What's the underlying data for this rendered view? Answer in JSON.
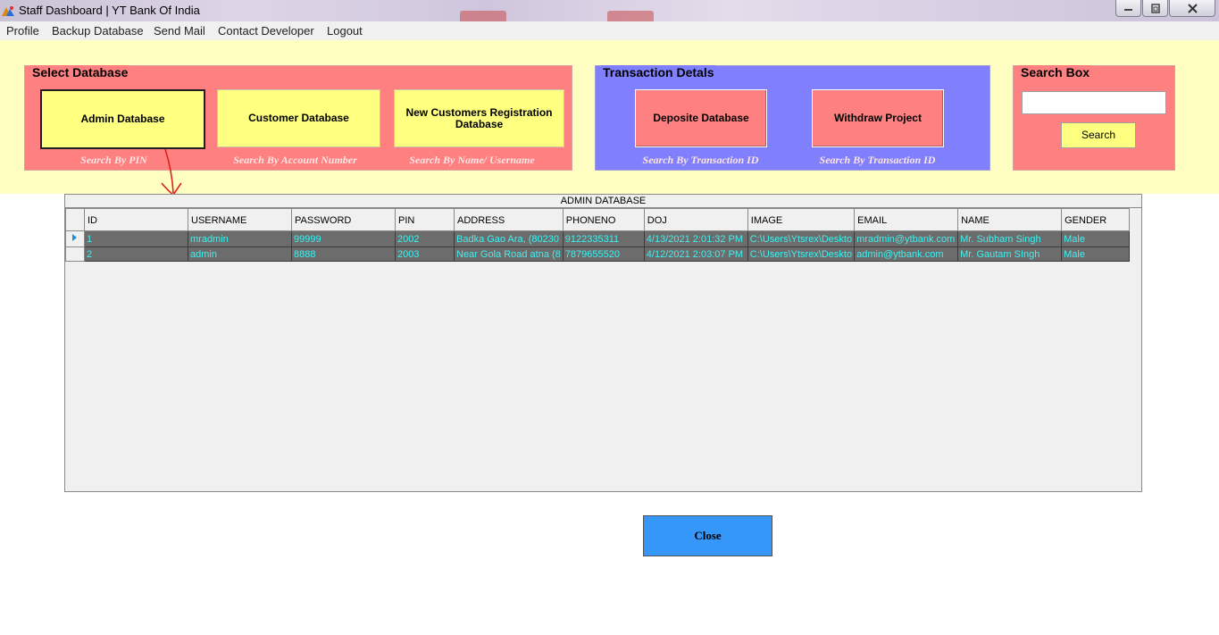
{
  "window": {
    "title": "Staff Dashboard | YT Bank Of India",
    "minimize": "minimize-icon",
    "restore": "restore-icon",
    "close": "close-icon"
  },
  "menu": {
    "items": [
      "Profile",
      "Backup Database",
      "Send Mail",
      "Contact Developer",
      "Logout"
    ]
  },
  "select_database": {
    "title": "Select Database",
    "buttons": [
      "Admin Database",
      "Customer Database",
      "New Customers Registration Database"
    ],
    "hints": [
      "Search By PIN",
      "Search By Account Number",
      "Search By Name/ Username"
    ]
  },
  "transaction": {
    "title": "Transaction Detals",
    "buttons": [
      "Deposite Database",
      "Withdraw Project"
    ],
    "hints": [
      "Search By Transaction ID",
      "Search By Transaction ID"
    ]
  },
  "search_box": {
    "title": "Search Box",
    "input_value": "",
    "button": "Search"
  },
  "grid": {
    "caption": "ADMIN DATABASE",
    "columns": [
      "ID",
      "USERNAME",
      "PASSWORD",
      "PIN",
      "ADDRESS",
      "PHONENO",
      "DOJ",
      "IMAGE",
      "EMAIL",
      "NAME",
      "GENDER"
    ],
    "rows": [
      [
        "1",
        "mradmin",
        "99999",
        "2002",
        "Badka Gao Ara, (80230",
        "9122335311",
        "4/13/2021 2:01:32 PM",
        "C:\\Users\\Ytsrex\\Deskto",
        "mradmin@ytbank.com",
        "Mr. Subham Singh",
        "Male"
      ],
      [
        "2",
        "admin",
        "8888",
        "2003",
        "Near Gola Road atna (8",
        "7879655520",
        "4/12/2021 2:03:07 PM",
        "C:\\Users\\Ytsrex\\Deskto",
        "admin@ytbank.com",
        "Mr. Gautam SIngh",
        "Male"
      ]
    ]
  },
  "close_button": "Close",
  "colors": {
    "panel_bg": "#ffffc2",
    "pink": "#fe8080",
    "blue": "#8080fe",
    "yellow_button": "#ffff80",
    "close_button": "#3597fa",
    "row_bg": "#6c6c6c",
    "row_text": "#40f0f0"
  }
}
